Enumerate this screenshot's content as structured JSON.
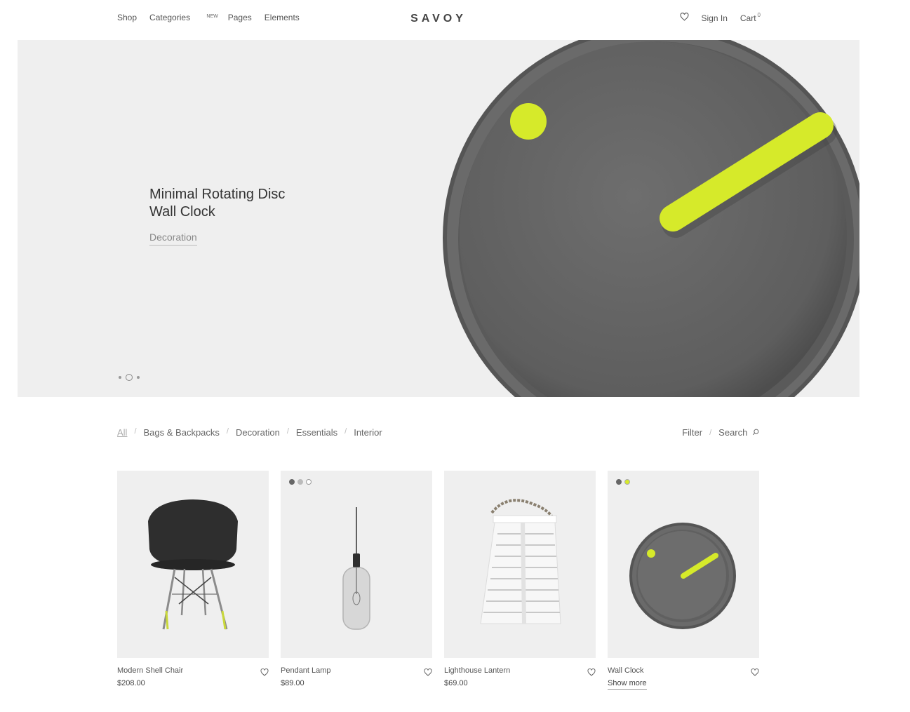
{
  "header": {
    "nav": [
      {
        "label": "Shop"
      },
      {
        "label": "Categories",
        "badge": "NEW"
      },
      {
        "label": "Pages"
      },
      {
        "label": "Elements"
      }
    ],
    "logo": "SAVOY",
    "sign_in": "Sign In",
    "cart_label": "Cart",
    "cart_count": "0"
  },
  "hero": {
    "title_line1": "Minimal Rotating Disc",
    "title_line2": "Wall Clock",
    "category": "Decoration",
    "slides_total": 3,
    "slide_active": 2
  },
  "filters": {
    "categories": [
      "All",
      "Bags & Backpacks",
      "Decoration",
      "Essentials",
      "Interior"
    ],
    "active": "All",
    "filter_label": "Filter",
    "search_label": "Search"
  },
  "products": [
    {
      "name": "Modern Shell Chair",
      "price": "$208.00",
      "swatches": []
    },
    {
      "name": "Pendant Lamp",
      "price": "$89.00",
      "swatches": [
        "#666666",
        "#bbbbbb",
        "#ffffff"
      ]
    },
    {
      "name": "Lighthouse Lantern",
      "price": "$69.00",
      "swatches": []
    },
    {
      "name": "Wall Clock",
      "show_more": "Show more",
      "swatches": [
        "#666666",
        "#d6ea2a"
      ]
    }
  ],
  "colors": {
    "accent": "#d6ea2a",
    "clock_gray": "#6d6d6d",
    "background": "#efefef"
  }
}
